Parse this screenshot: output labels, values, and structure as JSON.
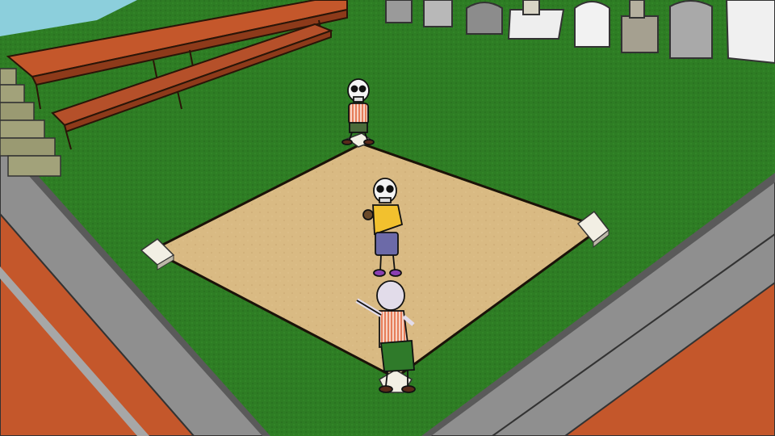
{
  "scene": {
    "type": "cartoon skeleton baseball field in a graveyard",
    "colors": {
      "grass": "#2e7d24",
      "grass_dark": "#1f5a17",
      "dirt": "#d9ba83",
      "dirt_edge": "#3a2a18",
      "wall_grey": "#8f8f8f",
      "wall_dark": "#5a5a5a",
      "bleacher_red": "#c4572b",
      "bench_red": "#b5502a",
      "stone_grey": "#a9a9a9",
      "stone_light": "#e6e6e6",
      "base_white": "#f2efe4",
      "uniform_orange_stripes": "#f0a07a",
      "uniform_yellow": "#f2c12e",
      "pants_purple": "#6c6aa8",
      "pants_green": "#2f7a2a",
      "shoes_purple": "#8a3fb2",
      "shoes_brown": "#5a2a1a",
      "sky": "#7fc7d8"
    }
  },
  "characters": [
    {
      "role": "fielder at second base",
      "icon": "skeleton-crouching"
    },
    {
      "role": "pitcher",
      "icon": "skeleton-yellow-shirt"
    },
    {
      "role": "batter at home plate",
      "icon": "skeleton-pointing"
    }
  ]
}
